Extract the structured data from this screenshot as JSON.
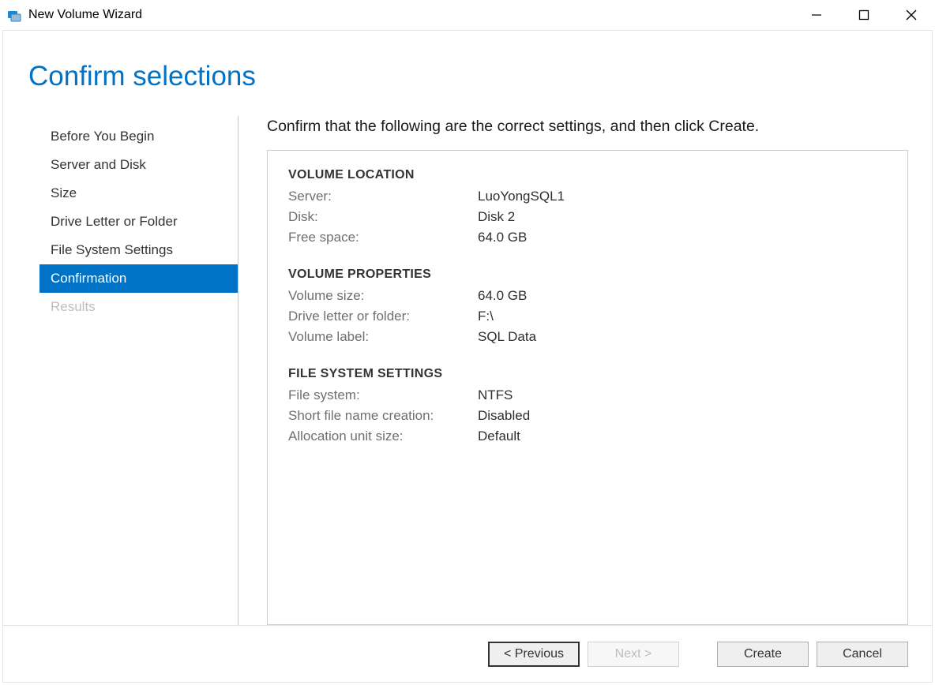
{
  "window": {
    "title": "New Volume Wizard"
  },
  "page": {
    "heading": "Confirm selections",
    "instruction": "Confirm that the following are the correct settings, and then click Create."
  },
  "sidebar": {
    "items": [
      {
        "label": "Before You Begin",
        "state": "normal"
      },
      {
        "label": "Server and Disk",
        "state": "normal"
      },
      {
        "label": "Size",
        "state": "normal"
      },
      {
        "label": "Drive Letter or Folder",
        "state": "normal"
      },
      {
        "label": "File System Settings",
        "state": "normal"
      },
      {
        "label": "Confirmation",
        "state": "selected"
      },
      {
        "label": "Results",
        "state": "disabled"
      }
    ]
  },
  "sections": {
    "volume_location": {
      "header": "VOLUME LOCATION",
      "server_label": "Server:",
      "server_value": "LuoYongSQL1",
      "disk_label": "Disk:",
      "disk_value": "Disk 2",
      "free_space_label": "Free space:",
      "free_space_value": "64.0 GB"
    },
    "volume_properties": {
      "header": "VOLUME PROPERTIES",
      "size_label": "Volume size:",
      "size_value": "64.0 GB",
      "drive_label": "Drive letter or folder:",
      "drive_value": "F:\\",
      "vlabel_label": "Volume label:",
      "vlabel_value": "SQL Data"
    },
    "file_system": {
      "header": "FILE SYSTEM SETTINGS",
      "fs_label": "File system:",
      "fs_value": "NTFS",
      "short_label": "Short file name creation:",
      "short_value": "Disabled",
      "alloc_label": "Allocation unit size:",
      "alloc_value": "Default"
    }
  },
  "footer": {
    "previous": "< Previous",
    "next": "Next >",
    "create": "Create",
    "cancel": "Cancel"
  }
}
